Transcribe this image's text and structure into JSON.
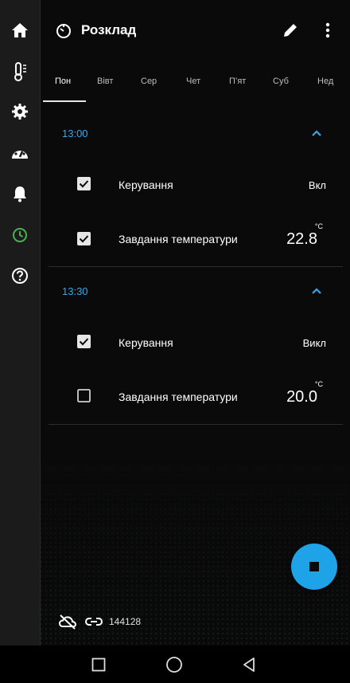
{
  "header": {
    "title": "Розклад"
  },
  "tabs": [
    "Пон",
    "Вівт",
    "Сер",
    "Чет",
    "П’ят",
    "Суб",
    "Нед"
  ],
  "schedule": [
    {
      "time": "13:00",
      "rows": [
        {
          "label": "Керування",
          "checked": true,
          "value": "Вкл"
        },
        {
          "label": "Завдання температури",
          "checked": true,
          "value": "22.8",
          "unit": "°C"
        }
      ]
    },
    {
      "time": "13:30",
      "rows": [
        {
          "label": "Керування",
          "checked": true,
          "value": "Викл"
        },
        {
          "label": "Завдання температури",
          "checked": false,
          "value": "20.0",
          "unit": "°C"
        }
      ]
    }
  ],
  "status": {
    "device_id": "144128"
  },
  "colors": {
    "accent": "#3ba6e6",
    "fab": "#1ea3e8",
    "active_nav": "#4caf50"
  }
}
